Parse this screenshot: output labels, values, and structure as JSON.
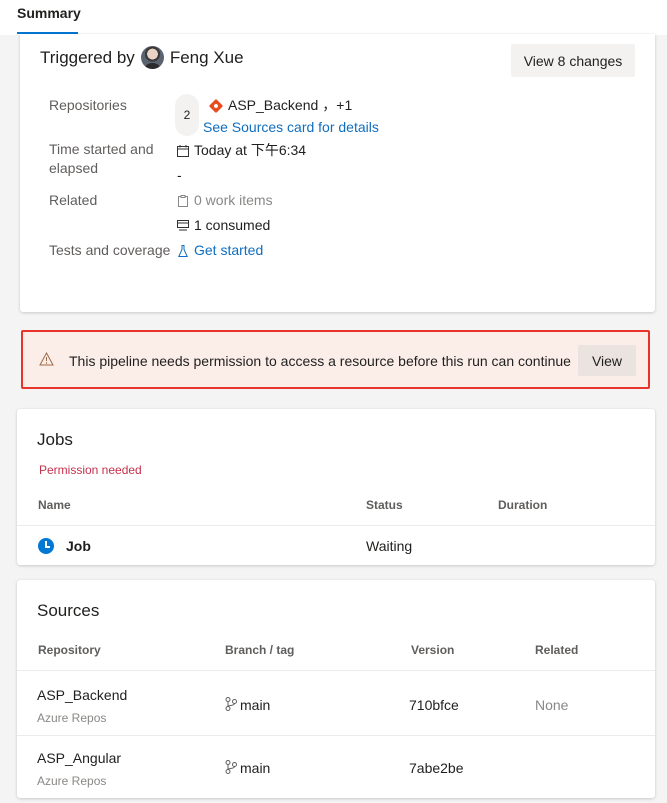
{
  "tabs": {
    "summary": "Summary"
  },
  "summary": {
    "triggered_by_label": "Triggered by",
    "user_name": "Feng Xue",
    "view_changes_button": "View 8 changes",
    "repositories_label": "Repositories",
    "repo_count": "2",
    "repo_name": "ASP_Backend",
    "repo_more": "，+1",
    "sources_link": "See Sources card for details",
    "time_label_line1": "Time started and",
    "time_label_line2": "elapsed",
    "time_started": "Today at 下午6:34",
    "elapsed": "-",
    "related_label": "Related",
    "work_items": "0 work items",
    "consumed": "1 consumed",
    "tests_label": "Tests and coverage",
    "get_started": "Get started"
  },
  "warning": {
    "message": "This pipeline needs permission to access a resource before this run can continue",
    "view_button": "View"
  },
  "jobs": {
    "title": "Jobs",
    "status_note": "Permission needed",
    "columns": {
      "name": "Name",
      "status": "Status",
      "duration": "Duration"
    },
    "rows": [
      {
        "name": "Job",
        "status": "Waiting",
        "duration": ""
      }
    ]
  },
  "sources": {
    "title": "Sources",
    "columns": {
      "repository": "Repository",
      "branch": "Branch / tag",
      "version": "Version",
      "related": "Related"
    },
    "rows": [
      {
        "repo": "ASP_Backend",
        "provider": "Azure Repos",
        "branch": "main",
        "version": "710bfce",
        "related": "None"
      },
      {
        "repo": "ASP_Angular",
        "provider": "Azure Repos",
        "branch": "main",
        "version": "7abe2be",
        "related": ""
      }
    ]
  },
  "colors": {
    "accent": "#0078d4",
    "warning_border": "#e8332a",
    "error_text": "#c4314b",
    "link": "#106ebe"
  }
}
